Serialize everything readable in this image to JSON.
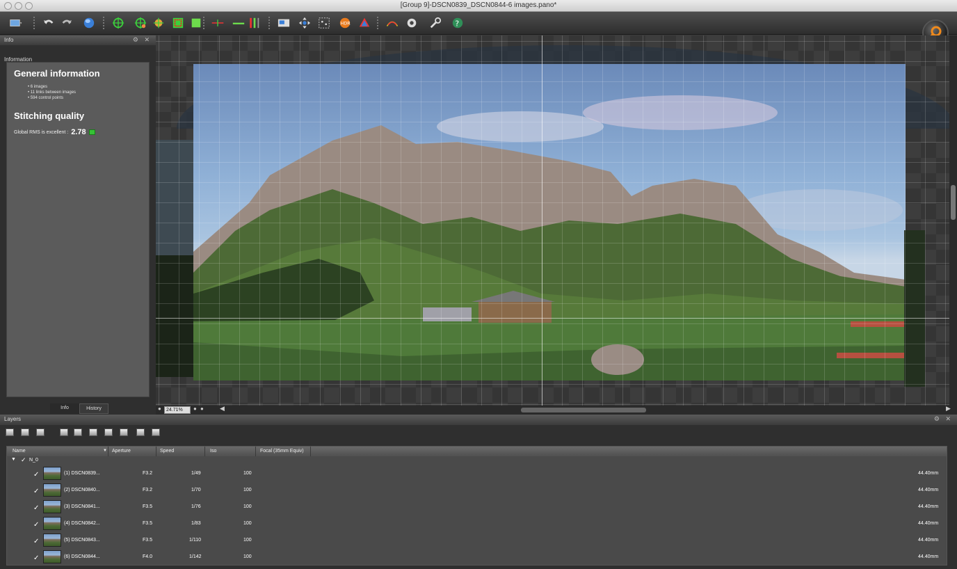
{
  "window": {
    "title": "[Group 9]-DSCN0839_DSCN0844-6 images.pano*"
  },
  "toolbar": {
    "icons": [
      "project-icon",
      "undo-icon",
      "redo-icon",
      "sphere-icon",
      "control-point-icon",
      "add-control-point-icon",
      "anchor-icon",
      "crop-icon",
      "mask-icon",
      "horizon-icon",
      "level-icon",
      "vertical-lines-icon",
      "preview-icon",
      "move-icon",
      "select-points-icon",
      "hdr-icon",
      "color-icon",
      "render-icon",
      "settings-icon",
      "tools-icon",
      "help-icon",
      "search-icon"
    ]
  },
  "info_panel": {
    "header": "Info",
    "controls": "⚙ ✕",
    "subheader": "Information",
    "general_title": "General information",
    "items": [
      "6 images",
      "11 links between images",
      "594 control points"
    ],
    "quality_title": "Stitching quality",
    "rms_label": "Global RMS is excellent :",
    "rms_value": "2.78",
    "tabs": [
      "Info",
      "History"
    ]
  },
  "canvas": {
    "zoom": "24.71%"
  },
  "layers": {
    "header": "Layers",
    "controls": "⚙ ✕",
    "columns": [
      "Name",
      "Aperture",
      "Speed",
      "Iso",
      "Focal (35mm Equiv)"
    ],
    "group": "N_0",
    "rows": [
      {
        "name": "(1) DSCN0839...",
        "aperture": "F3.2",
        "speed": "1/49",
        "iso": "100",
        "focal": "44.40mm"
      },
      {
        "name": "(2) DSCN0840...",
        "aperture": "F3.2",
        "speed": "1/70",
        "iso": "100",
        "focal": "44.40mm"
      },
      {
        "name": "(3) DSCN0841...",
        "aperture": "F3.5",
        "speed": "1/76",
        "iso": "100",
        "focal": "44.40mm"
      },
      {
        "name": "(4) DSCN0842...",
        "aperture": "F3.5",
        "speed": "1/83",
        "iso": "100",
        "focal": "44.40mm"
      },
      {
        "name": "(5) DSCN0843...",
        "aperture": "F3.5",
        "speed": "1/110",
        "iso": "100",
        "focal": "44.40mm"
      },
      {
        "name": "(6) DSCN0844...",
        "aperture": "F4.0",
        "speed": "1/142",
        "iso": "100",
        "focal": "44.40mm"
      }
    ]
  },
  "colors": {
    "accent": "#f08a1c",
    "rms_flag": "#36c236"
  }
}
